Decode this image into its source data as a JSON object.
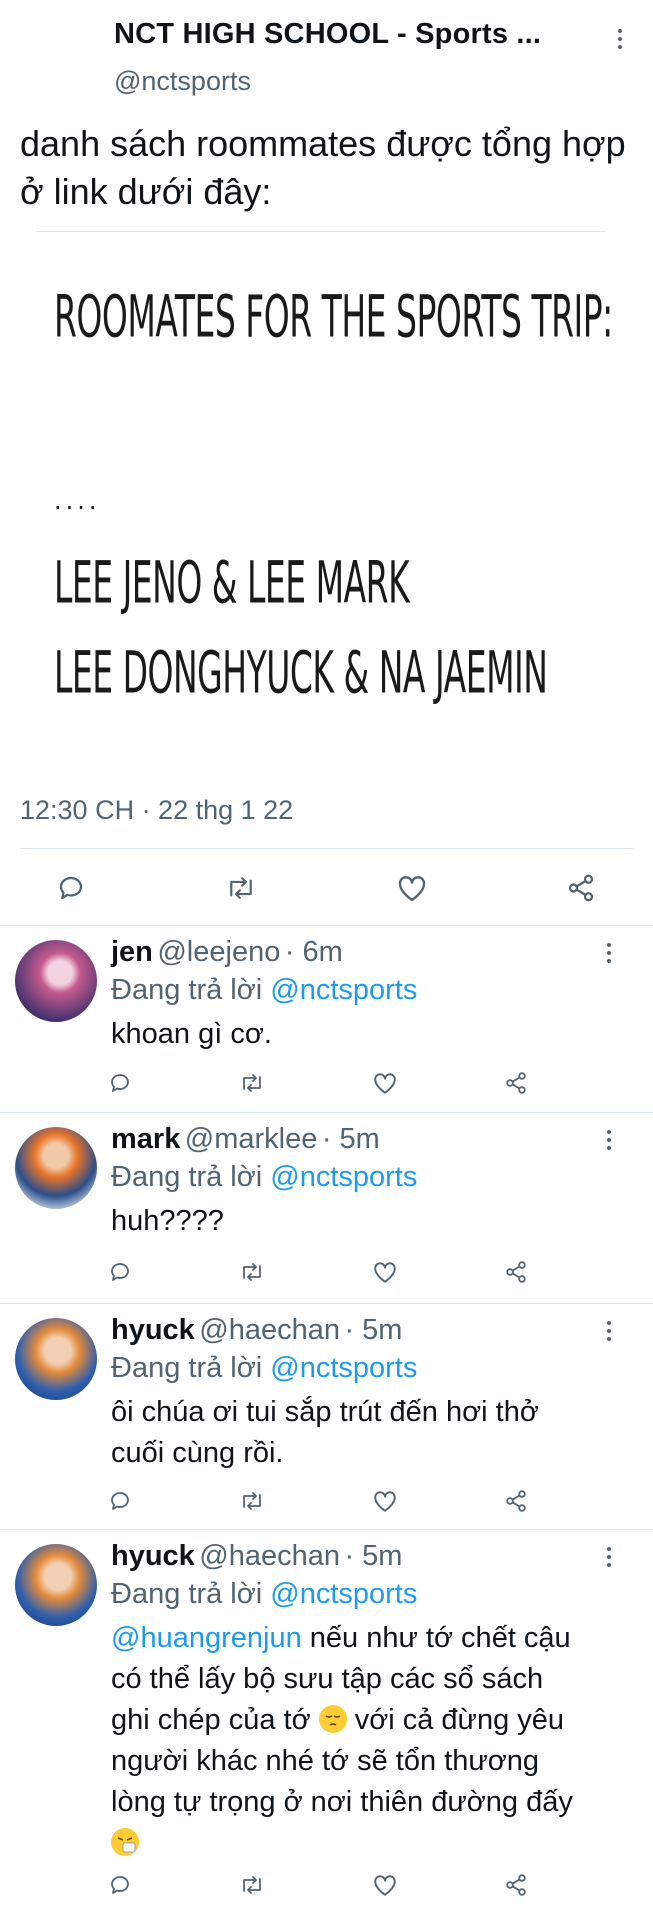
{
  "header": {
    "account_name": "NCT HIGH SCHOOL - Sports ...",
    "account_handle": "@nctsports",
    "more_icon": "more-vertical-icon"
  },
  "tweet": {
    "text": "danh sách roommates được tổng hợp ở link dưới đây:",
    "image": {
      "title": "ROOMATES FOR THE SPORTS TRIP:",
      "ellipsis": "....",
      "pair_1": "LEE JENO & LEE MARK",
      "pair_2": "LEE DONGHYUCK & NA JAEMIN"
    },
    "timestamp": "12:30 CH · 22 thg 1 22",
    "actions": [
      "reply-icon",
      "retweet-icon",
      "like-icon",
      "share-icon"
    ]
  },
  "replies": [
    {
      "name": "jen",
      "handle": "@leejeno",
      "time": "· 6m",
      "replying_prefix": "Đang trả lời",
      "replying_to": "@nctsports",
      "text": "khoan gì cơ.",
      "avatar_colors": [
        "#3b2f6a",
        "#c55a8f",
        "#f1d4e0"
      ]
    },
    {
      "name": "mark",
      "handle": "@marklee",
      "time": "· 5m",
      "replying_prefix": "Đang trả lời",
      "replying_to": "@nctsports",
      "text": "huh????",
      "avatar_colors": [
        "#d9e1ea",
        "#2b4f8c",
        "#e8742a"
      ]
    },
    {
      "name": "hyuck",
      "handle": "@haechan",
      "time": "· 5m",
      "replying_prefix": "Đang trả lời",
      "replying_to": "@nctsports",
      "text_line_1": "ôi chúa ơi tui sắp trút đến hơi thở",
      "text_line_2": "cuối cùng rồi.",
      "avatar_colors": [
        "#2f5fae",
        "#e38a3a",
        "#f3d0b4"
      ]
    },
    {
      "name": "hyuck",
      "handle": "@haechan",
      "time": "· 5m",
      "replying_prefix": "Đang trả lời",
      "replying_to": "@nctsports",
      "mention": "@huangrenjun",
      "text_line_1": " nếu như tớ chết cậu",
      "text_line_2": "có thể lấy bộ sưu tập các sổ sách",
      "text_line_3a": "ghi chép của tớ ",
      "text_line_3b": " với cả đừng yêu",
      "text_line_4": "người khác nhé tớ sẽ tổn thương",
      "text_line_5": "lòng tự trọng ở nơi thiên đường đấy",
      "emoji_1": "pensive-face-emoji",
      "emoji_2": "sneezing-face-emoji",
      "avatar_colors": [
        "#2f5fae",
        "#e38a3a",
        "#f3d0b4"
      ]
    }
  ],
  "colors": {
    "link": "#1d9bf0",
    "secondary_text": "#536471",
    "divider": "#e1e8ed"
  }
}
